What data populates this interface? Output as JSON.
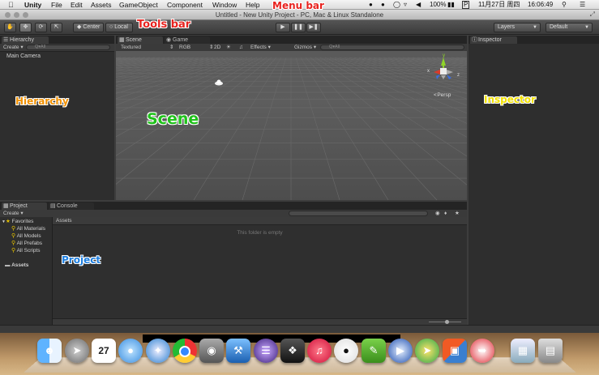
{
  "menubar": {
    "app": "Unity",
    "items": [
      "File",
      "Edit",
      "Assets",
      "GameObject",
      "Component",
      "Window",
      "Help"
    ],
    "battery": "100%",
    "date": "11月27日 周四",
    "time": "16:06:49",
    "input_method": "P"
  },
  "window": {
    "title": "Untitled - New Unity Project - PC, Mac & Linux Standalone"
  },
  "toolbar": {
    "center_label": "Center",
    "local_label": "Local",
    "layers_label": "Layers",
    "layout_label": "Default"
  },
  "hierarchy": {
    "tab": "Hierarchy",
    "create": "Create",
    "search_placeholder": "Q▾All",
    "items": [
      "Main Camera"
    ]
  },
  "scene": {
    "tabs": [
      "Scene",
      "Game"
    ],
    "shading": "Textured",
    "render_mode": "RGB",
    "mode_2d": "2D",
    "effects": "Effects",
    "gizmos": "Gizmos",
    "search_placeholder": "Q▾All",
    "persp": "Persp",
    "axes": {
      "x": "x",
      "y": "y",
      "z": "z"
    }
  },
  "inspector": {
    "tab": "Inspector"
  },
  "project": {
    "tabs": [
      "Project",
      "Console"
    ],
    "create": "Create",
    "favorites": "Favorites",
    "favorite_items": [
      "All Materials",
      "All Models",
      "All Prefabs",
      "All Scripts"
    ],
    "assets": "Assets",
    "breadcrumb": "Assets",
    "empty_message": "This folder is empty"
  },
  "annotations": {
    "menu_bar": "Menu bar",
    "tools_bar": "Tools bar",
    "hierarchy": "Hierarchy",
    "scene": "Scene",
    "inspector": "Inspector",
    "project": "Project"
  },
  "colors": {
    "annot_red": "#e8231f",
    "annot_orange": "#f29100",
    "annot_green": "#1fc21a",
    "annot_yellow": "#f2e100",
    "annot_blue": "#1e7fe0"
  },
  "dock": {
    "icons": [
      "finder-icon",
      "launchpad-icon",
      "calendar-icon",
      "messages-icon",
      "safari-icon",
      "chrome-icon",
      "facetime-icon",
      "xcode-icon",
      "eclipse-icon",
      "unity-icon",
      "itunes-icon",
      "qq-icon",
      "evernote-icon",
      "quicktime-icon",
      "marker-icon",
      "vmware-icon",
      "navicat-icon",
      "dashboard-icon",
      "trash-icon"
    ],
    "calendar_day": "27"
  }
}
